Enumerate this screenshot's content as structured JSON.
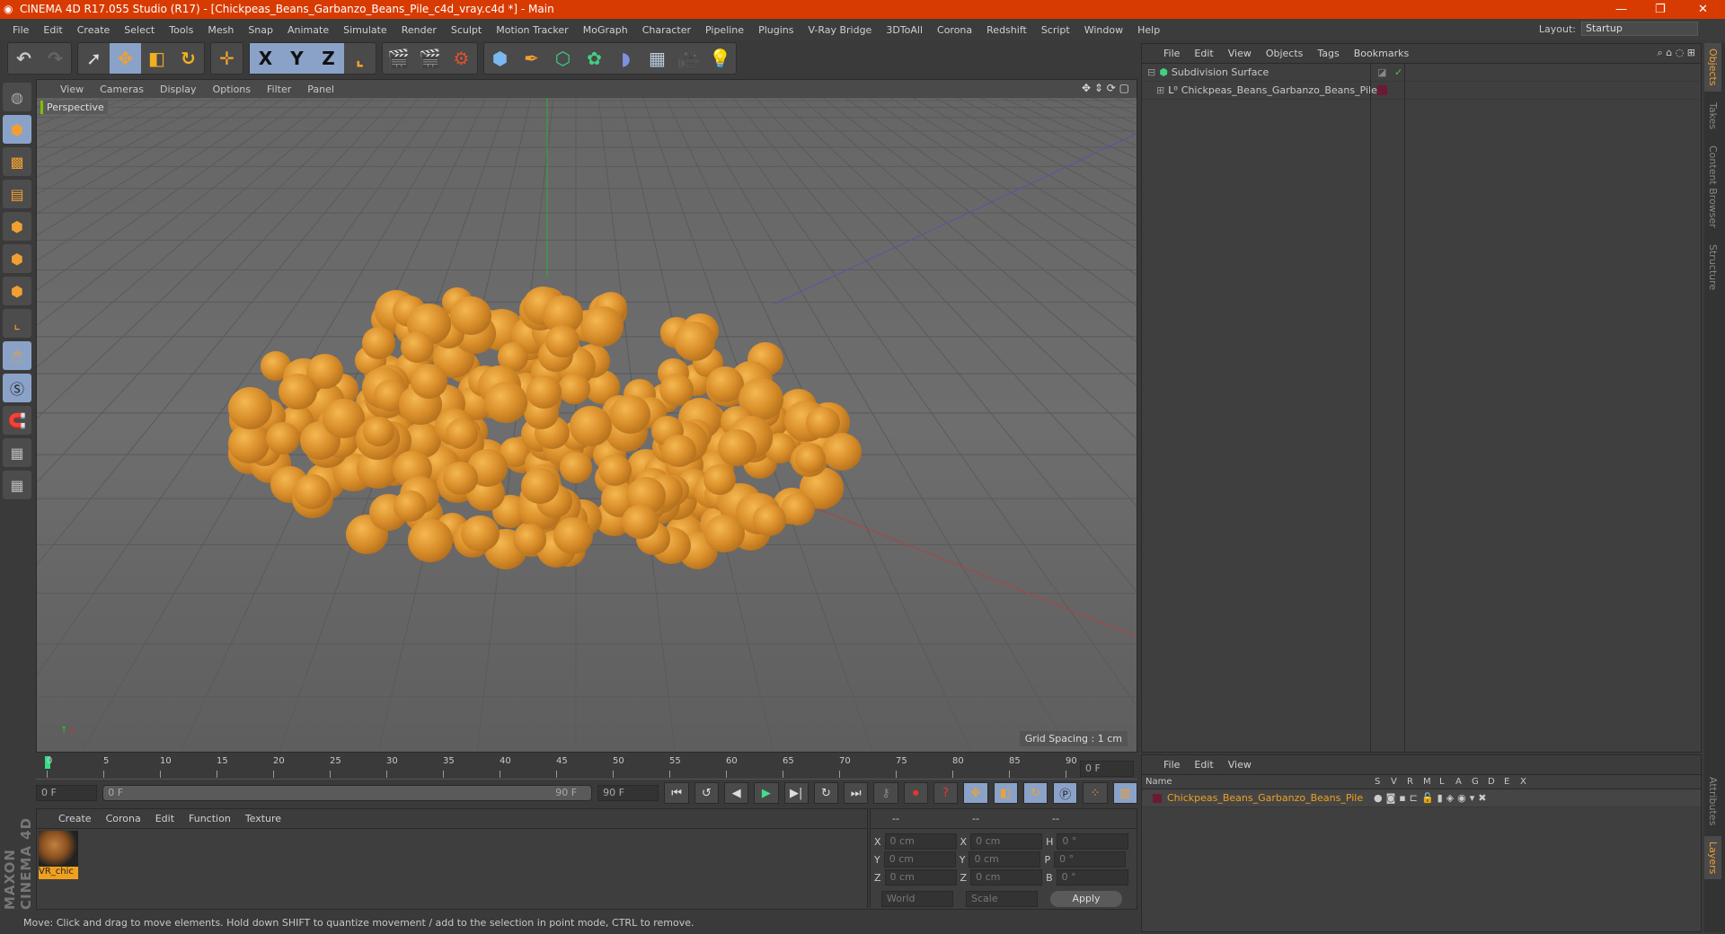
{
  "window": {
    "title": "CINEMA 4D R17.055 Studio (R17) - [Chickpeas_Beans_Garbanzo_Beans_Pile_c4d_vray.c4d *] - Main",
    "controls": [
      "—",
      "❐",
      "✕"
    ]
  },
  "menu": [
    "File",
    "Edit",
    "Create",
    "Select",
    "Tools",
    "Mesh",
    "Snap",
    "Animate",
    "Simulate",
    "Render",
    "Sculpt",
    "Motion Tracker",
    "MoGraph",
    "Character",
    "Pipeline",
    "Plugins",
    "V-Ray Bridge",
    "3DToAll",
    "Corona",
    "Redshift",
    "Script",
    "Window",
    "Help"
  ],
  "layout": {
    "label": "Layout:",
    "value": "Startup"
  },
  "toolbar": {
    "axis": [
      "X",
      "Y",
      "Z"
    ]
  },
  "viewport": {
    "menu": [
      "View",
      "Cameras",
      "Display",
      "Options",
      "Filter",
      "Panel"
    ],
    "camera": "Perspective",
    "grid_spacing": "Grid Spacing : 1 cm"
  },
  "objects": {
    "menu": [
      "File",
      "Edit",
      "View",
      "Objects",
      "Tags",
      "Bookmarks"
    ],
    "items": [
      {
        "name": "Subdivision Surface"
      },
      {
        "name": "Chickpeas_Beans_Garbanzo_Beans_Pile",
        "color": "#6b1a33"
      }
    ]
  },
  "vtabs": [
    "Objects",
    "Takes",
    "Content Browser",
    "Structure"
  ],
  "vtabs_bottom": [
    "Attributes",
    "Layers"
  ],
  "timeline": {
    "ticks": [
      "0",
      "5",
      "10",
      "15",
      "20",
      "25",
      "30",
      "35",
      "40",
      "45",
      "50",
      "55",
      "60",
      "65",
      "70",
      "75",
      "80",
      "85",
      "90"
    ],
    "current": "0 F",
    "start": "0 F",
    "range_start": "0 F",
    "range_end": "90 F",
    "end": "90 F"
  },
  "materials": {
    "menu": [
      "Create",
      "Corona",
      "Edit",
      "Function",
      "Texture"
    ],
    "items": [
      {
        "name": "VR_chic"
      }
    ]
  },
  "coords": {
    "headers": [
      "--",
      "--",
      "--"
    ],
    "rows": [
      {
        "a": "X",
        "v1": "0 cm",
        "b": "X",
        "v2": "0 cm",
        "c": "H",
        "v3": "0 °"
      },
      {
        "a": "Y",
        "v1": "0 cm",
        "b": "Y",
        "v2": "0 cm",
        "c": "P",
        "v3": "0 °"
      },
      {
        "a": "Z",
        "v1": "0 cm",
        "b": "Z",
        "v2": "0 cm",
        "c": "B",
        "v3": "0 °"
      }
    ],
    "mode": "World",
    "transform": "Scale",
    "apply": "Apply"
  },
  "layers": {
    "menu": [
      "File",
      "Edit",
      "View"
    ],
    "columns": [
      "Name",
      "S",
      "V",
      "R",
      "M",
      "L",
      "A",
      "G",
      "D",
      "E",
      "X"
    ],
    "items": [
      {
        "name": "Chickpeas_Beans_Garbanzo_Beans_Pile",
        "color": "#6b1a33"
      }
    ]
  },
  "status": "Move: Click and drag to move elements. Hold down SHIFT to quantize movement / add to the selection in point mode, CTRL to remove.",
  "brand": "MAXON CINEMA 4D"
}
